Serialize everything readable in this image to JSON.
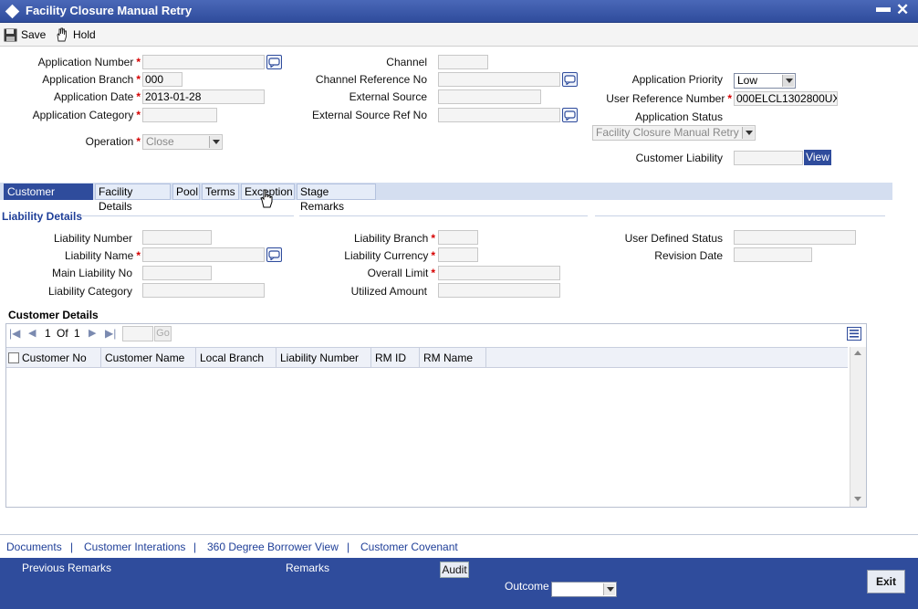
{
  "window": {
    "title": "Facility Closure Manual Retry"
  },
  "toolbar": {
    "save_label": "Save",
    "hold_label": "Hold"
  },
  "form": {
    "application_number_label": "Application Number",
    "application_number_value": "",
    "application_branch_label": "Application Branch",
    "application_branch_value": "000",
    "application_date_label": "Application Date",
    "application_date_value": "2013-01-28",
    "application_category_label": "Application Category",
    "application_category_value": "",
    "operation_label": "Operation",
    "operation_value": "Close",
    "channel_label": "Channel",
    "channel_value": "",
    "channel_reference_label": "Channel Reference No",
    "channel_reference_value": "",
    "external_source_label": "External Source",
    "external_source_value": "",
    "external_source_ref_label": "External Source Ref No",
    "external_source_ref_value": "",
    "application_priority_label": "Application Priority",
    "application_priority_value": "Low",
    "user_reference_label": "User Reference Number",
    "user_reference_value": "000ELCL1302800UX",
    "application_status_label": "Application Status",
    "application_status_value": "Facility Closure Manual Retry",
    "customer_liability_label": "Customer Liability",
    "customer_liability_value": "",
    "view_label": "View"
  },
  "tabs": [
    {
      "label": "Customer Details",
      "active": true
    },
    {
      "label": "Facility Details",
      "active": false
    },
    {
      "label": "Pool",
      "active": false
    },
    {
      "label": "Terms",
      "active": false
    },
    {
      "label": "Exception",
      "active": false
    },
    {
      "label": "Stage Remarks",
      "active": false
    }
  ],
  "liability": {
    "section_title": "Liability Details",
    "liability_number_label": "Liability Number",
    "liability_name_label": "Liability Name",
    "main_liability_label": "Main Liability No",
    "liability_category_label": "Liability Category",
    "liability_branch_label": "Liability Branch",
    "liability_currency_label": "Liability Currency",
    "overall_limit_label": "Overall Limit",
    "utilized_amount_label": "Utilized Amount",
    "user_defined_status_label": "User Defined Status",
    "revision_date_label": "Revision Date"
  },
  "customer_grid": {
    "title": "Customer Details",
    "page_current": "1",
    "page_of": "Of",
    "page_total": "1",
    "go_label": "Go",
    "columns": [
      "Customer No",
      "Customer Name",
      "Local Branch",
      "Liability Number",
      "RM ID",
      "RM Name"
    ],
    "rows": []
  },
  "links": [
    "Documents",
    "Customer Interations",
    "360 Degree Borrower View",
    "Customer Covenant"
  ],
  "link_separator": "|",
  "footer": {
    "previous_remarks_label": "Previous Remarks",
    "remarks_label": "Remarks",
    "audit_label": "Audit",
    "outcome_label": "Outcome",
    "outcome_value": "",
    "exit_label": "Exit"
  },
  "colors": {
    "brand": "#2f4c9c",
    "required": "#d60000",
    "link": "#1f3f98"
  }
}
